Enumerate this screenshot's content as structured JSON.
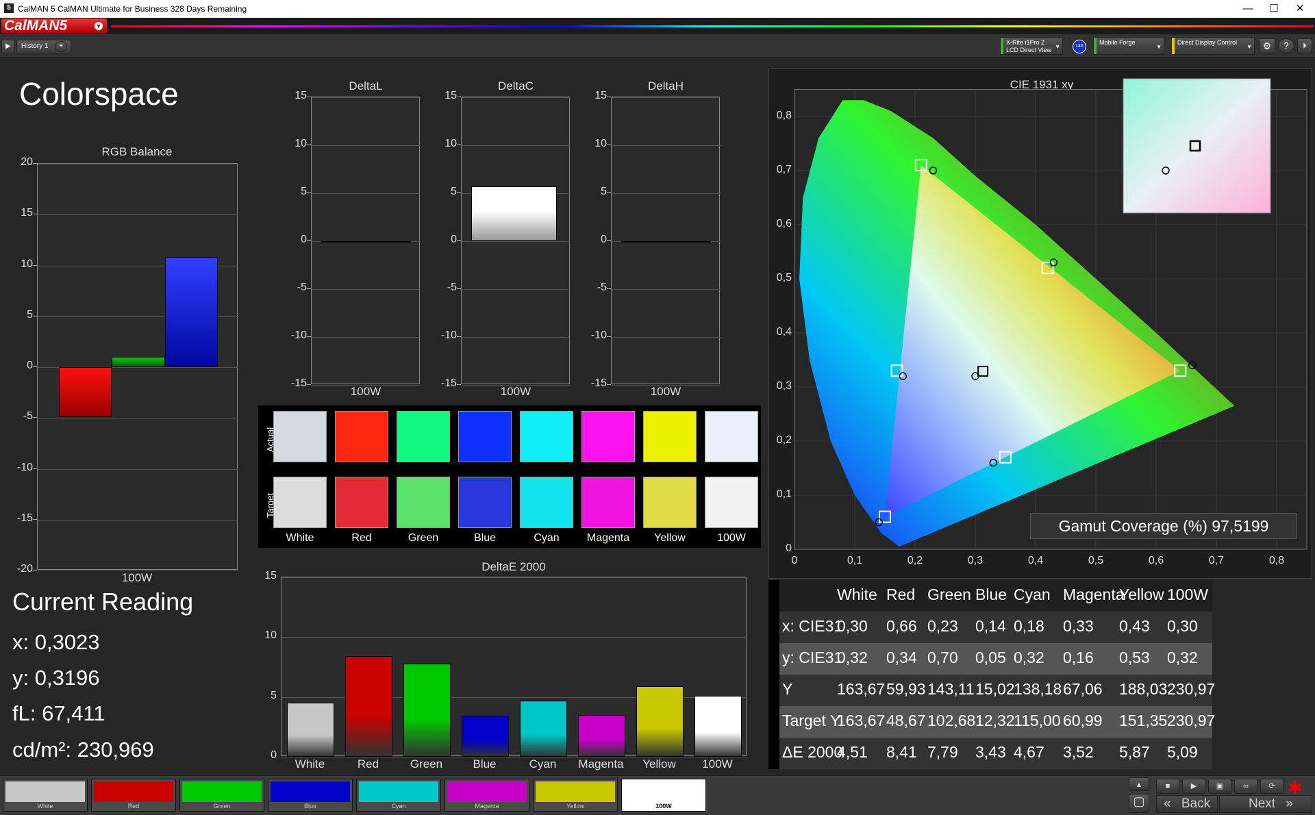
{
  "window": {
    "title": "CalMAN 5 CalMAN Ultimate for Business 328 Days Remaining",
    "logo_text": "5",
    "minimize": "—",
    "maximize": "☐",
    "close": "✕"
  },
  "brand": {
    "name": "CalMAN5",
    "menu_icon": "chevron-down-icon"
  },
  "toolbar": {
    "history_tab": "History 1",
    "add_tab": "+",
    "device1_line1": "X-Rite i1Pro 2",
    "device1_line2": "LCD Direct View",
    "badge": "146",
    "device2": "Mobile Forge",
    "device3": "Direct Display Control",
    "gear": "⚙",
    "help": "?",
    "pin": "⏵",
    "colors": {
      "device1": "#3cb43c",
      "device2": "#3cb43c",
      "device3": "#e6c800",
      "badge": "#1030d0"
    }
  },
  "page": {
    "title": "Colorspace"
  },
  "rgb_balance": {
    "title": "RGB Balance",
    "yticks": [
      "20",
      "15",
      "10",
      "5",
      "0",
      "-5",
      "-10",
      "-15",
      "-20"
    ],
    "xlabel": "100W"
  },
  "deltaL": {
    "title": "DeltaL",
    "yticks": [
      "15",
      "10",
      "5",
      "0",
      "-5",
      "-10",
      "-15"
    ],
    "xlabel": "100W"
  },
  "deltaC": {
    "title": "DeltaC",
    "yticks": [
      "15",
      "10",
      "5",
      "0",
      "-5",
      "-10",
      "-15"
    ],
    "xlabel": "100W"
  },
  "deltaH": {
    "title": "DeltaH",
    "yticks": [
      "15",
      "10",
      "5",
      "0",
      "-5",
      "-10",
      "-15"
    ],
    "xlabel": "100W"
  },
  "swatches": {
    "actual_label": "Actual",
    "target_label": "Target",
    "names": [
      "White",
      "Red",
      "Green",
      "Blue",
      "Cyan",
      "Magenta",
      "Yellow",
      "100W"
    ],
    "actual": [
      "#d3d9df",
      "#ff2610",
      "#10f880",
      "#1030ff",
      "#10eef8",
      "#fb12f0",
      "#eaf200",
      "#e9f1fb"
    ],
    "target": [
      "#dcdcdc",
      "#e32a35",
      "#5ae36a",
      "#2a37de",
      "#12e2ee",
      "#f014e0",
      "#e0de46",
      "#f2f2f2"
    ]
  },
  "deltaE": {
    "title": "DeltaE 2000",
    "yticks": [
      "15",
      "10",
      "5",
      "0"
    ],
    "categories": [
      "White",
      "Red",
      "Green",
      "Blue",
      "Cyan",
      "Magenta",
      "Yellow",
      "100W"
    ]
  },
  "current_reading": {
    "title": "Current Reading",
    "x": "x: 0,3023",
    "y": "y: 0,3196",
    "fl": "fL: 67,411",
    "cdm2": "cd/m²: 230,969"
  },
  "cie": {
    "title": "CIE 1931 xy",
    "xticks": [
      "0",
      "0,1",
      "0,2",
      "0,3",
      "0,4",
      "0,5",
      "0,6",
      "0,7",
      "0,8"
    ],
    "yticks": [
      "0,8",
      "0,7",
      "0,6",
      "0,5",
      "0,4",
      "0,3",
      "0,2",
      "0,1",
      "0"
    ],
    "gamut_label": "Gamut Coverage (%) 97,5199"
  },
  "table": {
    "headers": [
      "White",
      "Red",
      "Green",
      "Blue",
      "Cyan",
      "Magenta",
      "Yellow",
      "100W"
    ],
    "rows": [
      {
        "label": "x: CIE31",
        "values": [
          "0,30",
          "0,66",
          "0,23",
          "0,14",
          "0,18",
          "0,33",
          "0,43",
          "0,30"
        ]
      },
      {
        "label": "y: CIE31",
        "values": [
          "0,32",
          "0,34",
          "0,70",
          "0,05",
          "0,32",
          "0,16",
          "0,53",
          "0,32"
        ]
      },
      {
        "label": "Y",
        "values": [
          "163,67",
          "59,93",
          "143,11",
          "15,02",
          "138,18",
          "67,06",
          "188,03",
          "230,97"
        ]
      },
      {
        "label": "Target Y",
        "values": [
          "163,67",
          "48,67",
          "102,68",
          "12,32",
          "115,00",
          "60,99",
          "151,35",
          "230,97"
        ]
      },
      {
        "label": "ΔE 2000",
        "values": [
          "4,51",
          "8,41",
          "7,79",
          "3,43",
          "4,67",
          "3,52",
          "5,87",
          "5,09"
        ]
      }
    ]
  },
  "bottom_tabs": [
    {
      "label": "White",
      "color": "#c8c8c8"
    },
    {
      "label": "Red",
      "color": "#c80000"
    },
    {
      "label": "Green",
      "color": "#00c800"
    },
    {
      "label": "Blue",
      "color": "#0000c8"
    },
    {
      "label": "Cyan",
      "color": "#00c8c8"
    },
    {
      "label": "Magenta",
      "color": "#c800c8"
    },
    {
      "label": "Yellow",
      "color": "#c8c800"
    },
    {
      "label": "100W",
      "color": "#ffffff"
    }
  ],
  "nav": {
    "back": "Back",
    "next": "Next",
    "back_icon": "«",
    "next_icon": "»",
    "asterisk": "✱"
  },
  "chart_data": [
    {
      "type": "bar",
      "title": "RGB Balance",
      "categories": [
        "100W"
      ],
      "series": [
        {
          "values": [
            -4.9
          ]
        },
        {
          "values": [
            1.0
          ]
        },
        {
          "values": [
            10.8
          ]
        }
      ],
      "series_colors": [
        "#e00000",
        "#00a000",
        "#1020ff"
      ],
      "ylim": [
        -20,
        20
      ],
      "xlabel": "100W"
    },
    {
      "type": "bar",
      "title": "DeltaL",
      "categories": [
        "100W"
      ],
      "values": [
        0.0
      ],
      "ylim": [
        -15,
        15
      ]
    },
    {
      "type": "bar",
      "title": "DeltaC",
      "categories": [
        "100W"
      ],
      "values": [
        5.7
      ],
      "ylim": [
        -15,
        15
      ]
    },
    {
      "type": "bar",
      "title": "DeltaH",
      "categories": [
        "100W"
      ],
      "values": [
        0.0
      ],
      "ylim": [
        -15,
        15
      ]
    },
    {
      "type": "bar",
      "title": "DeltaE 2000",
      "categories": [
        "White",
        "Red",
        "Green",
        "Blue",
        "Cyan",
        "Magenta",
        "Yellow",
        "100W"
      ],
      "values": [
        4.51,
        8.41,
        7.79,
        3.43,
        4.67,
        3.52,
        5.87,
        5.09
      ],
      "colors": [
        "#c8c8c8",
        "#c80000",
        "#00c800",
        "#0000c8",
        "#00c8c8",
        "#c800c8",
        "#c8c800",
        "#ffffff"
      ],
      "ylim": [
        0,
        15
      ]
    },
    {
      "type": "scatter",
      "title": "CIE 1931 xy",
      "xlim": [
        0,
        0.85
      ],
      "ylim": [
        0,
        0.85
      ],
      "target_points": [
        {
          "name": "Red",
          "x": 0.64,
          "y": 0.33
        },
        {
          "name": "Green",
          "x": 0.21,
          "y": 0.71
        },
        {
          "name": "Blue",
          "x": 0.15,
          "y": 0.06
        },
        {
          "name": "Cyan",
          "x": 0.17,
          "y": 0.33
        },
        {
          "name": "Magenta",
          "x": 0.35,
          "y": 0.17
        },
        {
          "name": "Yellow",
          "x": 0.42,
          "y": 0.52
        },
        {
          "name": "White",
          "x": 0.3127,
          "y": 0.329
        }
      ],
      "measured_points": [
        {
          "name": "Red",
          "x": 0.66,
          "y": 0.34
        },
        {
          "name": "Green",
          "x": 0.23,
          "y": 0.7
        },
        {
          "name": "Blue",
          "x": 0.14,
          "y": 0.05
        },
        {
          "name": "Cyan",
          "x": 0.18,
          "y": 0.32
        },
        {
          "name": "Magenta",
          "x": 0.33,
          "y": 0.16
        },
        {
          "name": "Yellow",
          "x": 0.43,
          "y": 0.53
        },
        {
          "name": "White",
          "x": 0.3,
          "y": 0.32
        }
      ],
      "gamut_coverage_percent": 97.5199
    }
  ]
}
